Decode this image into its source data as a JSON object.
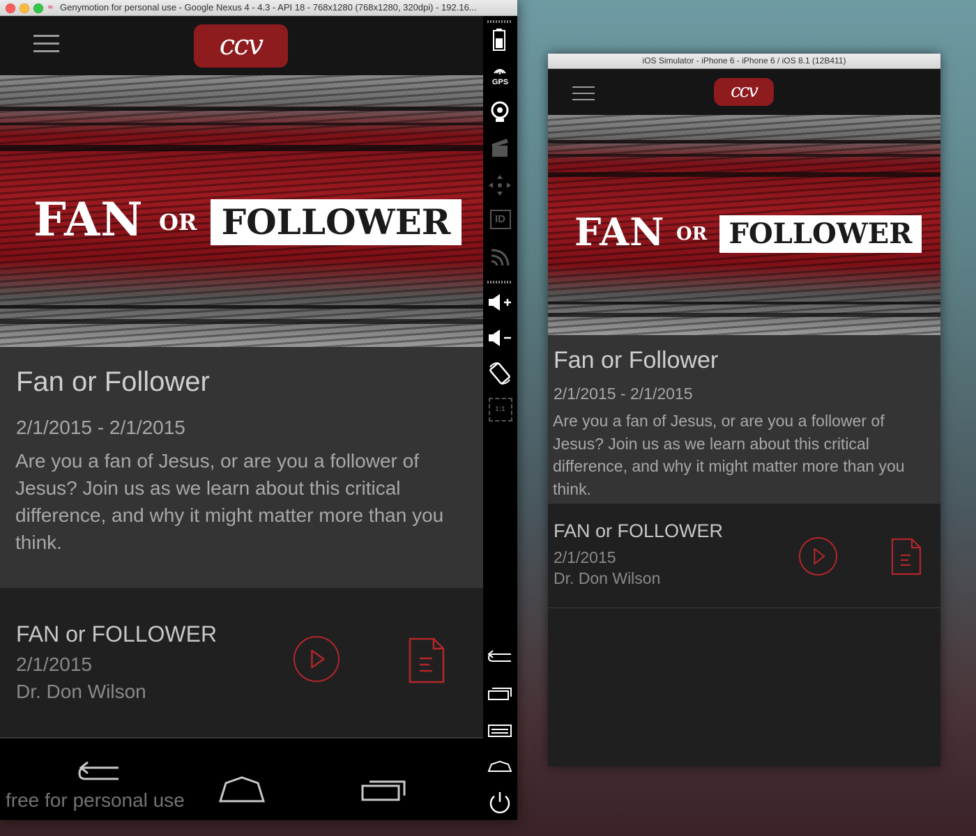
{
  "genymotion": {
    "window_title": "Genymotion for personal use - Google Nexus 4 - 4.3 - API 18 - 768x1280 (768x1280, 320dpi) - 192.16...",
    "logo_glyph": "∞",
    "watermark": "free for personal use",
    "side_toolbar": {
      "battery": "battery-icon",
      "gps_label": "GPS",
      "webcam": "webcam-icon",
      "capture": "clapper-icon",
      "dpad": "dpad-icon",
      "id_label": "ID",
      "network": "network-icon",
      "volume_up": "volume-up-icon",
      "volume_down": "volume-down-icon",
      "rotate": "rotate-icon",
      "scale_label": "1:1",
      "back": "back-icon",
      "recent": "recent-apps-icon",
      "menu": "menu-icon",
      "home": "home-icon",
      "power": "power-icon"
    }
  },
  "ios_simulator": {
    "window_title": "iOS Simulator - iPhone 6 - iPhone 6 / iOS 8.1 (12B411)"
  },
  "app": {
    "logo_text": "ccv",
    "banner": {
      "fan": "FAN",
      "or": "OR",
      "follower": "FOLLOWER"
    },
    "series": {
      "title": "Fan or Follower",
      "date_range": "2/1/2015 - 2/1/2015",
      "description": "Are you a fan of Jesus, or are you a follower of Jesus? Join us as we learn about this critical difference, and why it might matter more than you think."
    },
    "message": {
      "title": "FAN or FOLLOWER",
      "date": "2/1/2015",
      "speaker": "Dr. Don Wilson"
    }
  },
  "colors": {
    "accent": "#b3262b",
    "logo_bg": "#8e1b1e",
    "info_bg": "#343434",
    "message_bg": "#202020"
  }
}
